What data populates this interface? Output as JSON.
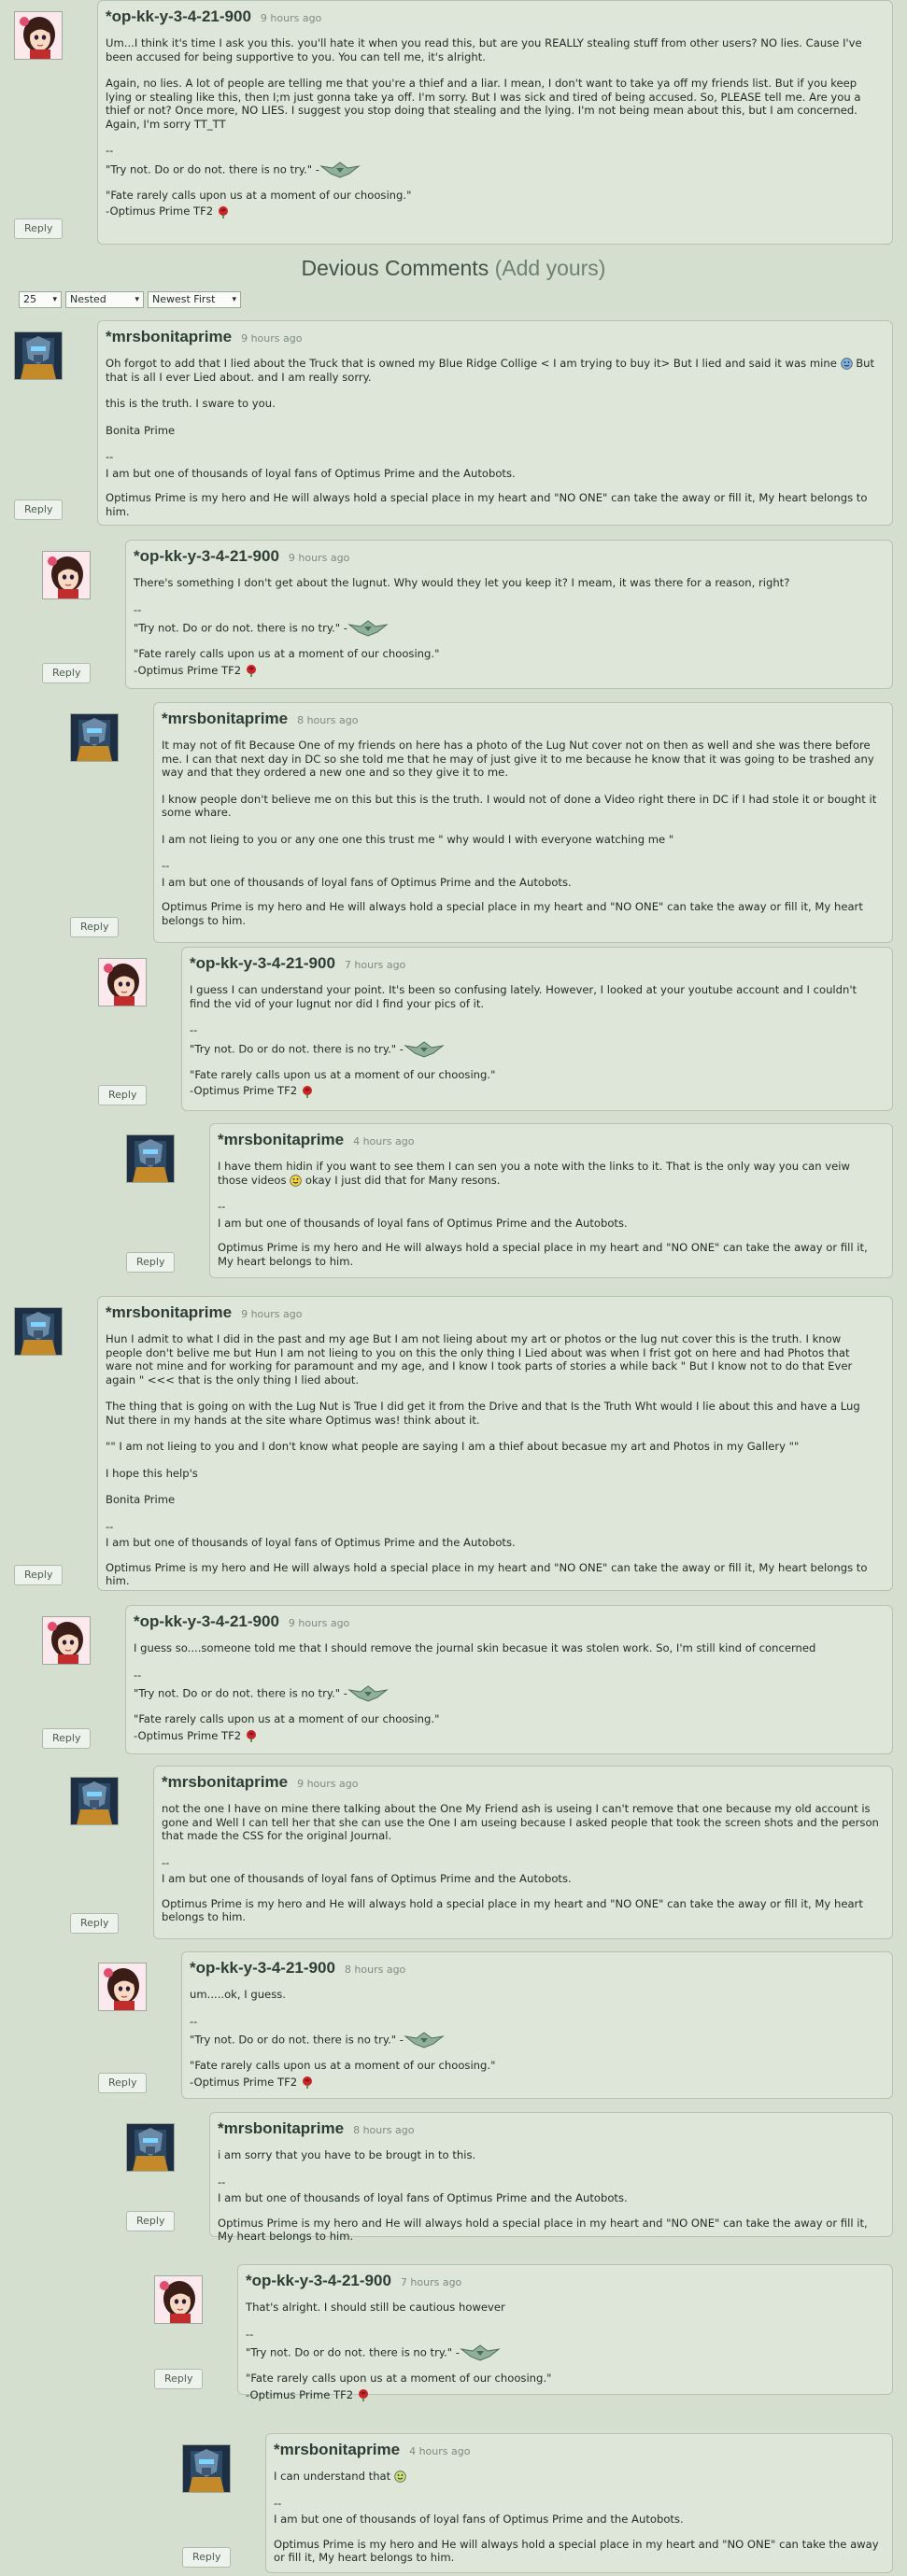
{
  "section_title": "Devious Comments",
  "add_yours": "(Add yours)",
  "controls": {
    "per_page": "25",
    "view": "Nested",
    "order": "Newest First"
  },
  "reply_label": "Reply",
  "users": {
    "op": {
      "name": "*op-kk-y-3-4-21-900",
      "avatar": "girl-avatar"
    },
    "mrs": {
      "name": "*mrsbonitaprime",
      "avatar": "robot-avatar"
    }
  },
  "comments": [
    {
      "user": "op",
      "time": "9 hours ago",
      "paragraphs": [
        "Um...I think it's time I ask you this. you'll hate it when you read this, but are you REALLY stealing stuff from other users? NO lies. Cause I've been accused for being supportive to you. You can tell me, it's alright.",
        "Again, no lies. A lot of people are telling me that you're a thief and a liar. I mean, I don't want to take ya off my friends list. But if you keep lying or stealing like this, then I;m just gonna take ya off. I'm sorry. But I was sick and tired of being accused. So, PLEASE tell me. Are you a thief or not? Once more, NO LIES. I suggest you stop doing that stealing and the lying. I'm not being mean about this, but I am concerned.\nAgain, I'm sorry TT_TT"
      ]
    },
    {
      "user": "mrs",
      "time": "9 hours ago",
      "paragraphs": [
        "Oh forgot to add that I lied about the Truck that is owned my Blue Ridge Collige < I am trying to buy it> But I lied and said it was mine [emo-blue] But that is all I ever Lied about. and I am really sorry.",
        "this is the truth. I sware to you.",
        "Bonita Prime"
      ]
    },
    {
      "user": "op",
      "time": "9 hours ago",
      "paragraphs": [
        "There's something I don't get about the lugnut. Why would they let you keep it? I meam, it was there for a reason, right?"
      ]
    },
    {
      "user": "mrs",
      "time": "8 hours ago",
      "paragraphs": [
        "It may not of fit Because One of my friends on here has a photo of the Lug Nut cover not on then as well and she was there before me. I can that next day in DC so she told me that he may of just give it to me because he know that it was going to be trashed any way and that they ordered a new one and so they give it to me.",
        "I know people don't believe me on this but this is the truth. I would not of done a Video right there in DC if I had stole it or bought it some whare.",
        "I am not lieing to you or any one one this trust me \" why would I with everyone watching me \""
      ]
    },
    {
      "user": "op",
      "time": "7 hours ago",
      "paragraphs": [
        "I guess I can understand your point. It's been so confusing lately. However, I looked at your youtube account and I couldn't find the vid of your lugnut nor did I find your pics of it."
      ]
    },
    {
      "user": "mrs",
      "time": "4 hours ago",
      "paragraphs": [
        "I have them hidin if you want to see them I can sen you a note with the links to it. That is the only way you can veiw those videos [emo-yellow] okay I just did that for Many resons."
      ]
    },
    {
      "user": "mrs",
      "time": "9 hours ago",
      "paragraphs": [
        "Hun I admit to what I did in the past and my age But I am not lieing about my art or photos or the lug nut cover this is the truth. I know people don't belive me but Hun I am not lieing to you on this the only thing I Lied about was when I frist got on here and had Photos that ware not mine and for working for paramount and my age, and I know I took parts of stories a while back \" But I know not to do that Ever again \" <<< that is the only thing I lied about.",
        "The thing that is going on with the Lug Nut is True I did get it from the Drive and that Is the Truth Wht would I lie about this and have a Lug Nut there in my hands at the site whare Optimus was! think about it.",
        "\"\" I am not lieing to you and I don't know what people are saying I am a thief about becasue my art and Photos in my Gallery \"\"",
        "I hope this help's",
        "Bonita Prime"
      ]
    },
    {
      "user": "op",
      "time": "9 hours ago",
      "paragraphs": [
        "I guess so....someone told me that I should remove the journal skin becasue it was stolen work. So, I'm still kind of concerned"
      ]
    },
    {
      "user": "mrs",
      "time": "9 hours ago",
      "paragraphs": [
        "not the one I have on mine there talking about the One My Friend ash is useing I can't remove that one because my old account is gone and Well I can tell her that she can use the One I am useing because I asked people that took the screen shots and the person that made the CSS for the original Journal."
      ]
    },
    {
      "user": "op",
      "time": "8 hours ago",
      "paragraphs": [
        "um.....ok, I guess."
      ]
    },
    {
      "user": "mrs",
      "time": "8 hours ago",
      "paragraphs": [
        "i am sorry that you have to be brougt in to this."
      ]
    },
    {
      "user": "op",
      "time": "7 hours ago",
      "paragraphs": [
        "That's alright. I should still be cautious however"
      ]
    },
    {
      "user": "mrs",
      "time": "4 hours ago",
      "paragraphs": [
        "I can understand that [emo-green]"
      ]
    }
  ],
  "signatures": {
    "op": {
      "dash": "--",
      "line1": "\"Try not. Do or do not. there is no try.\" -",
      "line2": "\"Fate rarely calls upon us at a moment of our choosing.\"",
      "line3": "-Optimus Prime TF2"
    },
    "mrs": {
      "dash": "--",
      "line1": "I am but one of thousands of loyal fans of Optimus Prime and the Autobots.",
      "line2": "Optimus Prime is my hero and He will always hold a special place in my heart and \"NO ONE\" can take the away or fill it, My heart belongs to him."
    }
  },
  "colors": {
    "page_bg": "#d4dfd0",
    "box_bg": "#dde6d9",
    "border": "#b5c3b2",
    "heading": "#425447"
  }
}
